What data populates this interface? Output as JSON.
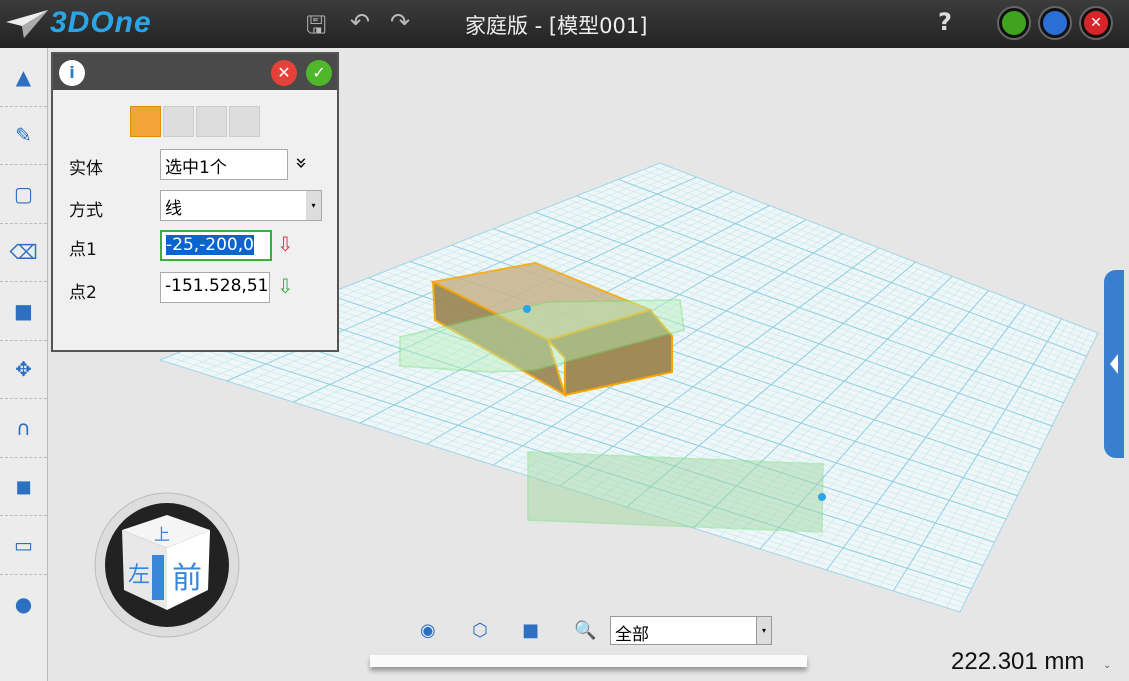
{
  "app": {
    "logo": "3DOne",
    "title": "家庭版 - [模型001]",
    "help": "?"
  },
  "toolbar": {
    "save": "save-icon",
    "undo": "undo-icon",
    "redo": "redo-icon"
  },
  "window_controls": {
    "minimize": "#3fa320",
    "maximize": "#2a6fd6",
    "close": "#d6262a"
  },
  "panel": {
    "rows": [
      {
        "label": "实体",
        "value": "选中1个"
      },
      {
        "label": "方式",
        "value": "线"
      },
      {
        "label": "点1",
        "value": "-25,-200,0"
      },
      {
        "label": "点2",
        "value": "-151.528,51"
      }
    ],
    "expand": "»"
  },
  "viewcube": {
    "top": "上",
    "left": "左",
    "front": "前"
  },
  "bottom": {
    "filter": "全部"
  },
  "status": {
    "measure": "222.301 mm"
  }
}
